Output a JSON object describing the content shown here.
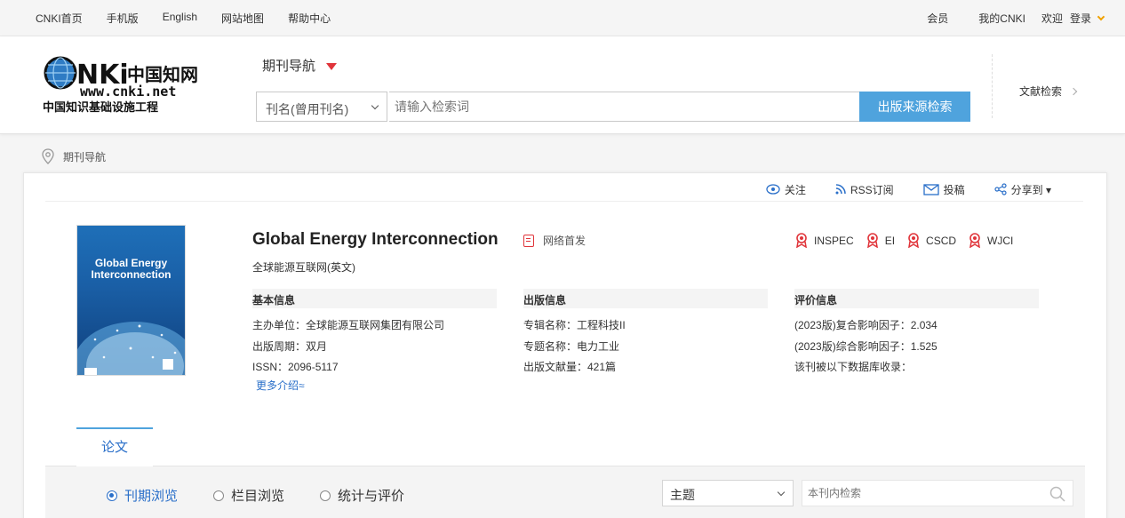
{
  "topbar": {
    "links": [
      "CNKI首页",
      "手机版",
      "English",
      "网站地图",
      "帮助中心"
    ],
    "member": "会员",
    "my_cnki": "我的CNKI",
    "welcome": "欢迎",
    "login": "登录"
  },
  "header": {
    "logo_url_text": "www.cnki.net",
    "logo_cn_text": "中国知网",
    "logo_tagline": "中国知识基础设施工程",
    "nav_title": "期刊导航",
    "select_value": "刊名(曾用刊名)",
    "search_placeholder": "请输入检索词",
    "search_button": "出版来源检索",
    "doc_search": "文献检索"
  },
  "breadcrumb": {
    "label": "期刊导航"
  },
  "actions": {
    "follow": "关注",
    "rss": "RSS订阅",
    "submit": "投稿",
    "share": "分享到 ▾"
  },
  "journal": {
    "title": "Global Energy Interconnection",
    "subtitle": "全球能源互联网(英文)",
    "net_first": "网络首发",
    "cover_title": "Global Energy Interconnection",
    "badges": [
      "INSPEC",
      "EI",
      "CSCD",
      "WJCI"
    ]
  },
  "basic_info": {
    "heading": "基本信息",
    "rows": [
      "主办单位：全球能源互联网集团有限公司",
      "出版周期：双月",
      "ISSN：2096-5117"
    ],
    "more": "更多介绍≈"
  },
  "pub_info": {
    "heading": "出版信息",
    "rows": [
      "专辑名称：工程科技II",
      "专题名称：电力工业",
      "出版文献量：421篇"
    ]
  },
  "eval_info": {
    "heading": "评价信息",
    "rows": [
      "(2023版)复合影响因子：2.034",
      "(2023版)综合影响因子：1.525",
      "该刊被以下数据库收录："
    ]
  },
  "tabs": {
    "papers": "论文"
  },
  "filters": {
    "options": [
      "刊期浏览",
      "栏目浏览",
      "统计与评价"
    ],
    "selected": "刊期浏览",
    "topic_select": "主题",
    "inner_search_placeholder": "本刊内检索"
  },
  "colors": {
    "accent_blue": "#4fa3dd",
    "link_blue": "#2a6fc9",
    "badge_red": "#e0343a",
    "login_arrow": "#f0a000"
  }
}
